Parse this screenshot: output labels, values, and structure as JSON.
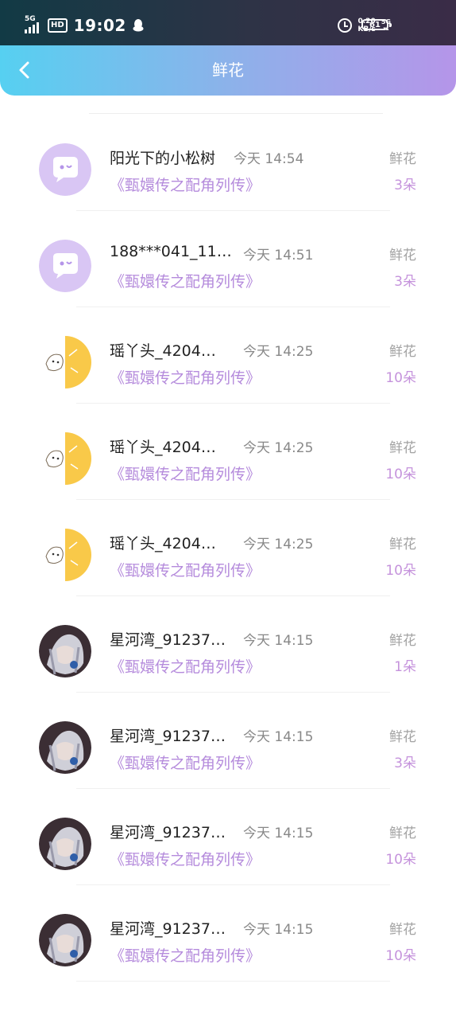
{
  "status_bar": {
    "network": "5G",
    "hd_badge": "HD",
    "time": "19:02",
    "speed_value": "0.20",
    "speed_unit": "KB/s",
    "network_right": "5G",
    "battery": "61"
  },
  "header": {
    "title": "鲜花",
    "background_colors": [
      "#56d0f1",
      "#b595e9"
    ]
  },
  "list": {
    "items": [
      {
        "name": "阳光下的小松树",
        "time": "今天 14:54",
        "book": "《甄嬛传之配角列传》",
        "gift": "鲜花",
        "count": "3朵",
        "avatar": "bubble-icon"
      },
      {
        "name": "188***041_11…",
        "time": "今天 14:51",
        "book": "《甄嬛传之配角列传》",
        "gift": "鲜花",
        "count": "3朵",
        "avatar": "bubble-icon"
      },
      {
        "name": "瑶丫头_4204…",
        "time": "今天 14:25",
        "book": "《甄嬛传之配角列传》",
        "gift": "鲜花",
        "count": "10朵",
        "avatar": "yellow-cat-avatar"
      },
      {
        "name": "瑶丫头_4204…",
        "time": "今天 14:25",
        "book": "《甄嬛传之配角列传》",
        "gift": "鲜花",
        "count": "10朵",
        "avatar": "yellow-cat-avatar"
      },
      {
        "name": "瑶丫头_4204…",
        "time": "今天 14:25",
        "book": "《甄嬛传之配角列传》",
        "gift": "鲜花",
        "count": "10朵",
        "avatar": "yellow-cat-avatar"
      },
      {
        "name": "星河湾_91237…",
        "time": "今天 14:15",
        "book": "《甄嬛传之配角列传》",
        "gift": "鲜花",
        "count": "1朵",
        "avatar": "anime-character-avatar"
      },
      {
        "name": "星河湾_91237…",
        "time": "今天 14:15",
        "book": "《甄嬛传之配角列传》",
        "gift": "鲜花",
        "count": "3朵",
        "avatar": "anime-character-avatar"
      },
      {
        "name": "星河湾_91237…",
        "time": "今天 14:15",
        "book": "《甄嬛传之配角列传》",
        "gift": "鲜花",
        "count": "10朵",
        "avatar": "anime-character-avatar"
      },
      {
        "name": "星河湾_91237…",
        "time": "今天 14:15",
        "book": "《甄嬛传之配角列传》",
        "gift": "鲜花",
        "count": "10朵",
        "avatar": "anime-character-avatar"
      }
    ]
  }
}
